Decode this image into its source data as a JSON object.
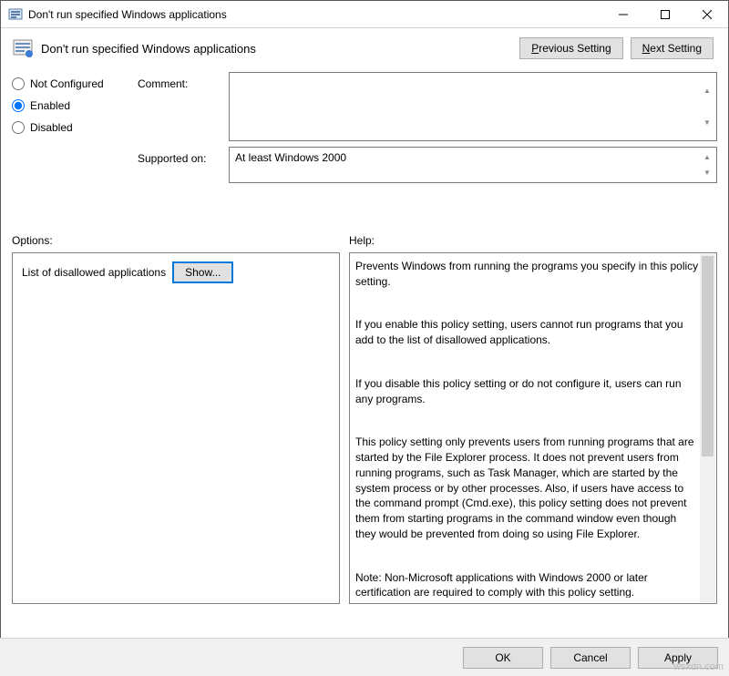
{
  "window": {
    "title": "Don't run specified Windows applications"
  },
  "header": {
    "policy_name": "Don't run specified Windows applications",
    "previous": "Previous Setting",
    "previous_key": "P",
    "next": "Next Setting",
    "next_key": "N"
  },
  "radios": {
    "not_configured": "Not Configured",
    "enabled": "Enabled",
    "disabled": "Disabled",
    "selected": "enabled"
  },
  "labels": {
    "comment": "Comment:",
    "supported": "Supported on:"
  },
  "fields": {
    "comment": "",
    "supported": "At least Windows 2000"
  },
  "sections": {
    "options": "Options:",
    "help": "Help:"
  },
  "options": {
    "row_label": "List of disallowed applications",
    "show": "Show..."
  },
  "help": {
    "p1": "Prevents Windows from running the programs you specify in this policy setting.",
    "p2": "If you enable this policy setting, users cannot run programs that you add to the list of disallowed applications.",
    "p3": "If you disable this policy setting or do not configure it, users can run any programs.",
    "p4": "This policy setting only prevents users from running programs that are started by the File Explorer process. It does not prevent users from running programs, such as Task Manager, which are started by the system process or by other processes.  Also, if users have access to the command prompt (Cmd.exe), this policy setting does not prevent them from starting programs in the command window even though they would be prevented from doing so using File Explorer.",
    "p5": "Note: Non-Microsoft applications with Windows 2000 or later certification are required to comply with this policy setting."
  },
  "footer": {
    "ok": "OK",
    "cancel": "Cancel",
    "apply": "Apply"
  },
  "watermark": "wsxdn.com"
}
